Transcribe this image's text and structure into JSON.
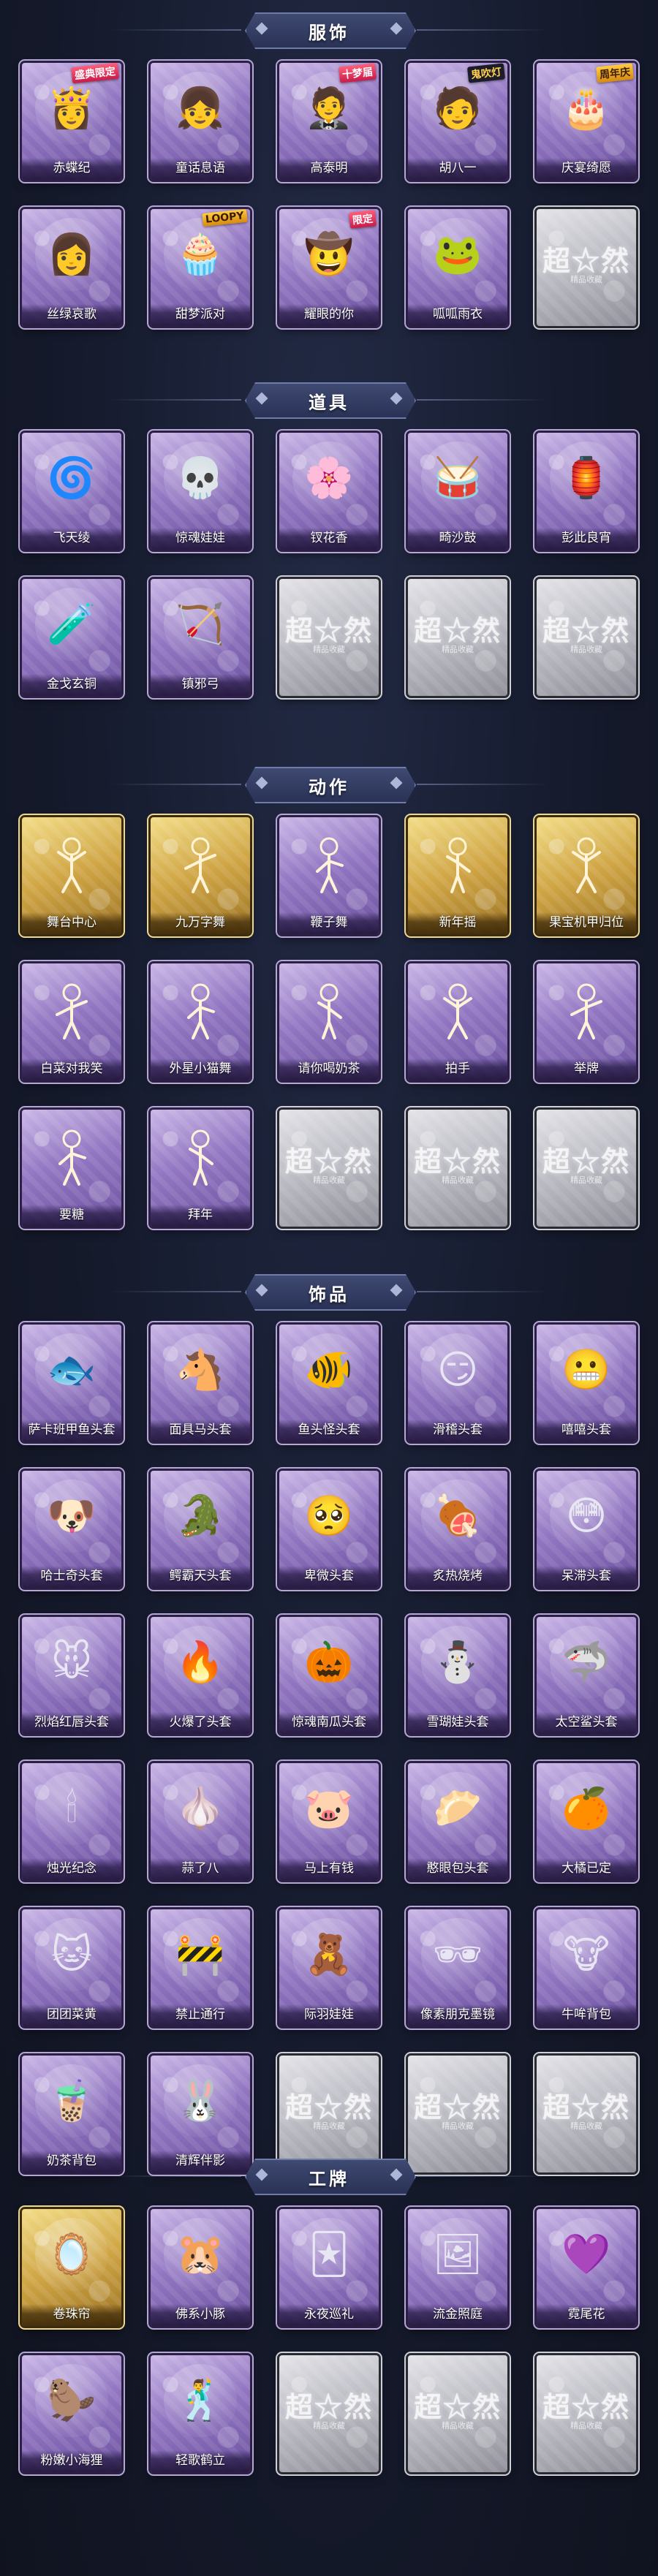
{
  "lock_logo": "超☆然",
  "lock_sub": "精品收藏",
  "sections": [
    {
      "title": "服饰",
      "items": [
        {
          "label": "赤蝶纪",
          "icon": "costume-portrait-icon",
          "glyph": "👸",
          "badge": "盛典限定"
        },
        {
          "label": "童话息语",
          "icon": "costume-portrait-icon",
          "glyph": "👧"
        },
        {
          "label": "高泰明",
          "icon": "costume-portrait-icon",
          "glyph": "🤵",
          "badge": "十梦届"
        },
        {
          "label": "胡八一",
          "icon": "costume-portrait-icon",
          "glyph": "🧑",
          "badge": "鬼吹灯"
        },
        {
          "label": "庆宴绮愿",
          "icon": "costume-portrait-icon",
          "glyph": "🎂",
          "badge": "周年庆"
        },
        {
          "label": "丝绿哀歌",
          "icon": "costume-portrait-icon",
          "glyph": "👩"
        },
        {
          "label": "甜梦派对",
          "icon": "costume-portrait-icon",
          "glyph": "🧁",
          "badge": "LOOPY"
        },
        {
          "label": "耀眼的你",
          "icon": "costume-portrait-icon",
          "glyph": "🤠",
          "badge": "限定"
        },
        {
          "label": "呱呱雨衣",
          "icon": "costume-portrait-icon",
          "glyph": "🐸"
        },
        {
          "locked": true
        }
      ]
    },
    {
      "title": "道具",
      "items": [
        {
          "label": "飞天绫",
          "icon": "ribbon-icon",
          "glyph": "🌀"
        },
        {
          "label": "惊魂娃娃",
          "icon": "doll-icon",
          "glyph": "💀"
        },
        {
          "label": "钗花香",
          "icon": "hairpin-icon",
          "glyph": "🌸"
        },
        {
          "label": "畸沙鼓",
          "icon": "drum-icon",
          "glyph": "🥁"
        },
        {
          "label": "彭此良宵",
          "icon": "lantern-icon",
          "glyph": "🏮"
        },
        {
          "label": "金戈玄铜",
          "icon": "bottle-icon",
          "glyph": "🧪"
        },
        {
          "label": "镇邪弓",
          "icon": "bow-icon",
          "glyph": "🏹"
        },
        {
          "locked": true
        },
        {
          "locked": true
        },
        {
          "locked": true
        }
      ]
    },
    {
      "title": "动作",
      "items": [
        {
          "label": "舞台中心",
          "icon": "pose-icon",
          "gold": true
        },
        {
          "label": "九万字舞",
          "icon": "pose-icon",
          "gold": true
        },
        {
          "label": "鞭子舞",
          "icon": "pose-icon"
        },
        {
          "label": "新年摇",
          "icon": "pose-icon",
          "gold": true
        },
        {
          "label": "果宝机甲归位",
          "icon": "pose-icon",
          "gold": true
        },
        {
          "label": "白菜对我笑",
          "icon": "pose-icon"
        },
        {
          "label": "外星小猫舞",
          "icon": "pose-icon"
        },
        {
          "label": "请你喝奶茶",
          "icon": "pose-icon"
        },
        {
          "label": "拍手",
          "icon": "pose-icon"
        },
        {
          "label": "举牌",
          "icon": "sign-icon"
        },
        {
          "label": "要糖",
          "icon": "pose-icon"
        },
        {
          "label": "拜年",
          "icon": "pose-icon"
        },
        {
          "locked": true
        },
        {
          "locked": true
        },
        {
          "locked": true
        }
      ]
    },
    {
      "title": "饰品",
      "items": [
        {
          "label": "萨卡班甲鱼头套",
          "icon": "fish-head-icon",
          "glyph": "🐟"
        },
        {
          "label": "面具马头套",
          "icon": "horse-head-icon",
          "glyph": "🐴"
        },
        {
          "label": "鱼头怪头套",
          "icon": "fish-monster-icon",
          "glyph": "🐠"
        },
        {
          "label": "滑稽头套",
          "icon": "smirk-face-icon",
          "glyph": "😏"
        },
        {
          "label": "嘻嘻头套",
          "icon": "grin-face-icon",
          "glyph": "😬"
        },
        {
          "label": "哈士奇头套",
          "icon": "dog-head-icon",
          "glyph": "🐶"
        },
        {
          "label": "鳄霸天头套",
          "icon": "croc-head-icon",
          "glyph": "🐊"
        },
        {
          "label": "卑微头套",
          "icon": "sad-face-icon",
          "glyph": "🥺"
        },
        {
          "label": "炙热烧烤",
          "icon": "bbq-icon",
          "glyph": "🍖"
        },
        {
          "label": "呆滞头套",
          "icon": "dazed-face-icon",
          "glyph": "😳"
        },
        {
          "label": "烈焰红唇头套",
          "icon": "pikachu-head-icon",
          "glyph": "🐭"
        },
        {
          "label": "火爆了头套",
          "icon": "fire-head-icon",
          "glyph": "🔥"
        },
        {
          "label": "惊魂南瓜头套",
          "icon": "pumpkin-icon",
          "glyph": "🎃"
        },
        {
          "label": "雪瑚娃头套",
          "icon": "snowman-icon",
          "glyph": "⛄"
        },
        {
          "label": "太空鲨头套",
          "icon": "shark-head-icon",
          "glyph": "🦈"
        },
        {
          "label": "烛光纪念",
          "icon": "candle-icon",
          "glyph": "🕯"
        },
        {
          "label": "蒜了八",
          "icon": "garlic-icon",
          "glyph": "🧄"
        },
        {
          "label": "马上有钱",
          "icon": "pig-bank-icon",
          "glyph": "🐷"
        },
        {
          "label": "憨眼包头套",
          "icon": "bun-head-icon",
          "glyph": "🥟"
        },
        {
          "label": "大橘已定",
          "icon": "orange-head-icon",
          "glyph": "🍊"
        },
        {
          "label": "团团菜黄",
          "icon": "cat-head-icon",
          "glyph": "🐱"
        },
        {
          "label": "禁止通行",
          "icon": "traffic-cone-icon",
          "glyph": "🚧"
        },
        {
          "label": "际羽娃娃",
          "icon": "doll-backpack-icon",
          "glyph": "🧸"
        },
        {
          "label": "像素朋克墨镜",
          "icon": "pixel-glasses-icon",
          "glyph": "🕶"
        },
        {
          "label": "牛哞背包",
          "icon": "cow-backpack-icon",
          "glyph": "🐮"
        },
        {
          "label": "奶茶背包",
          "icon": "milk-tea-icon",
          "glyph": "🧋"
        },
        {
          "label": "清辉伴影",
          "icon": "rabbit-icon",
          "glyph": "🐰"
        },
        {
          "locked": true
        },
        {
          "locked": true
        },
        {
          "locked": true
        }
      ]
    },
    {
      "title": "工牌",
      "items": [
        {
          "label": "卷珠帘",
          "icon": "badge-card-icon",
          "glyph": "🪞",
          "gold": true
        },
        {
          "label": "佛系小豚",
          "icon": "badge-card-icon",
          "glyph": "🐹"
        },
        {
          "label": "永夜巡礼",
          "icon": "badge-card-icon",
          "glyph": "🃏"
        },
        {
          "label": "流金照庭",
          "icon": "badge-card-icon",
          "glyph": "🖼"
        },
        {
          "label": "霓尾花",
          "icon": "badge-card-icon",
          "glyph": "💜"
        },
        {
          "label": "粉嫩小海狸",
          "icon": "badge-card-icon",
          "glyph": "🦫"
        },
        {
          "label": "轻歌鹤立",
          "icon": "badge-card-icon",
          "glyph": "🕺"
        },
        {
          "locked": true
        },
        {
          "locked": true
        },
        {
          "locked": true
        }
      ]
    }
  ]
}
